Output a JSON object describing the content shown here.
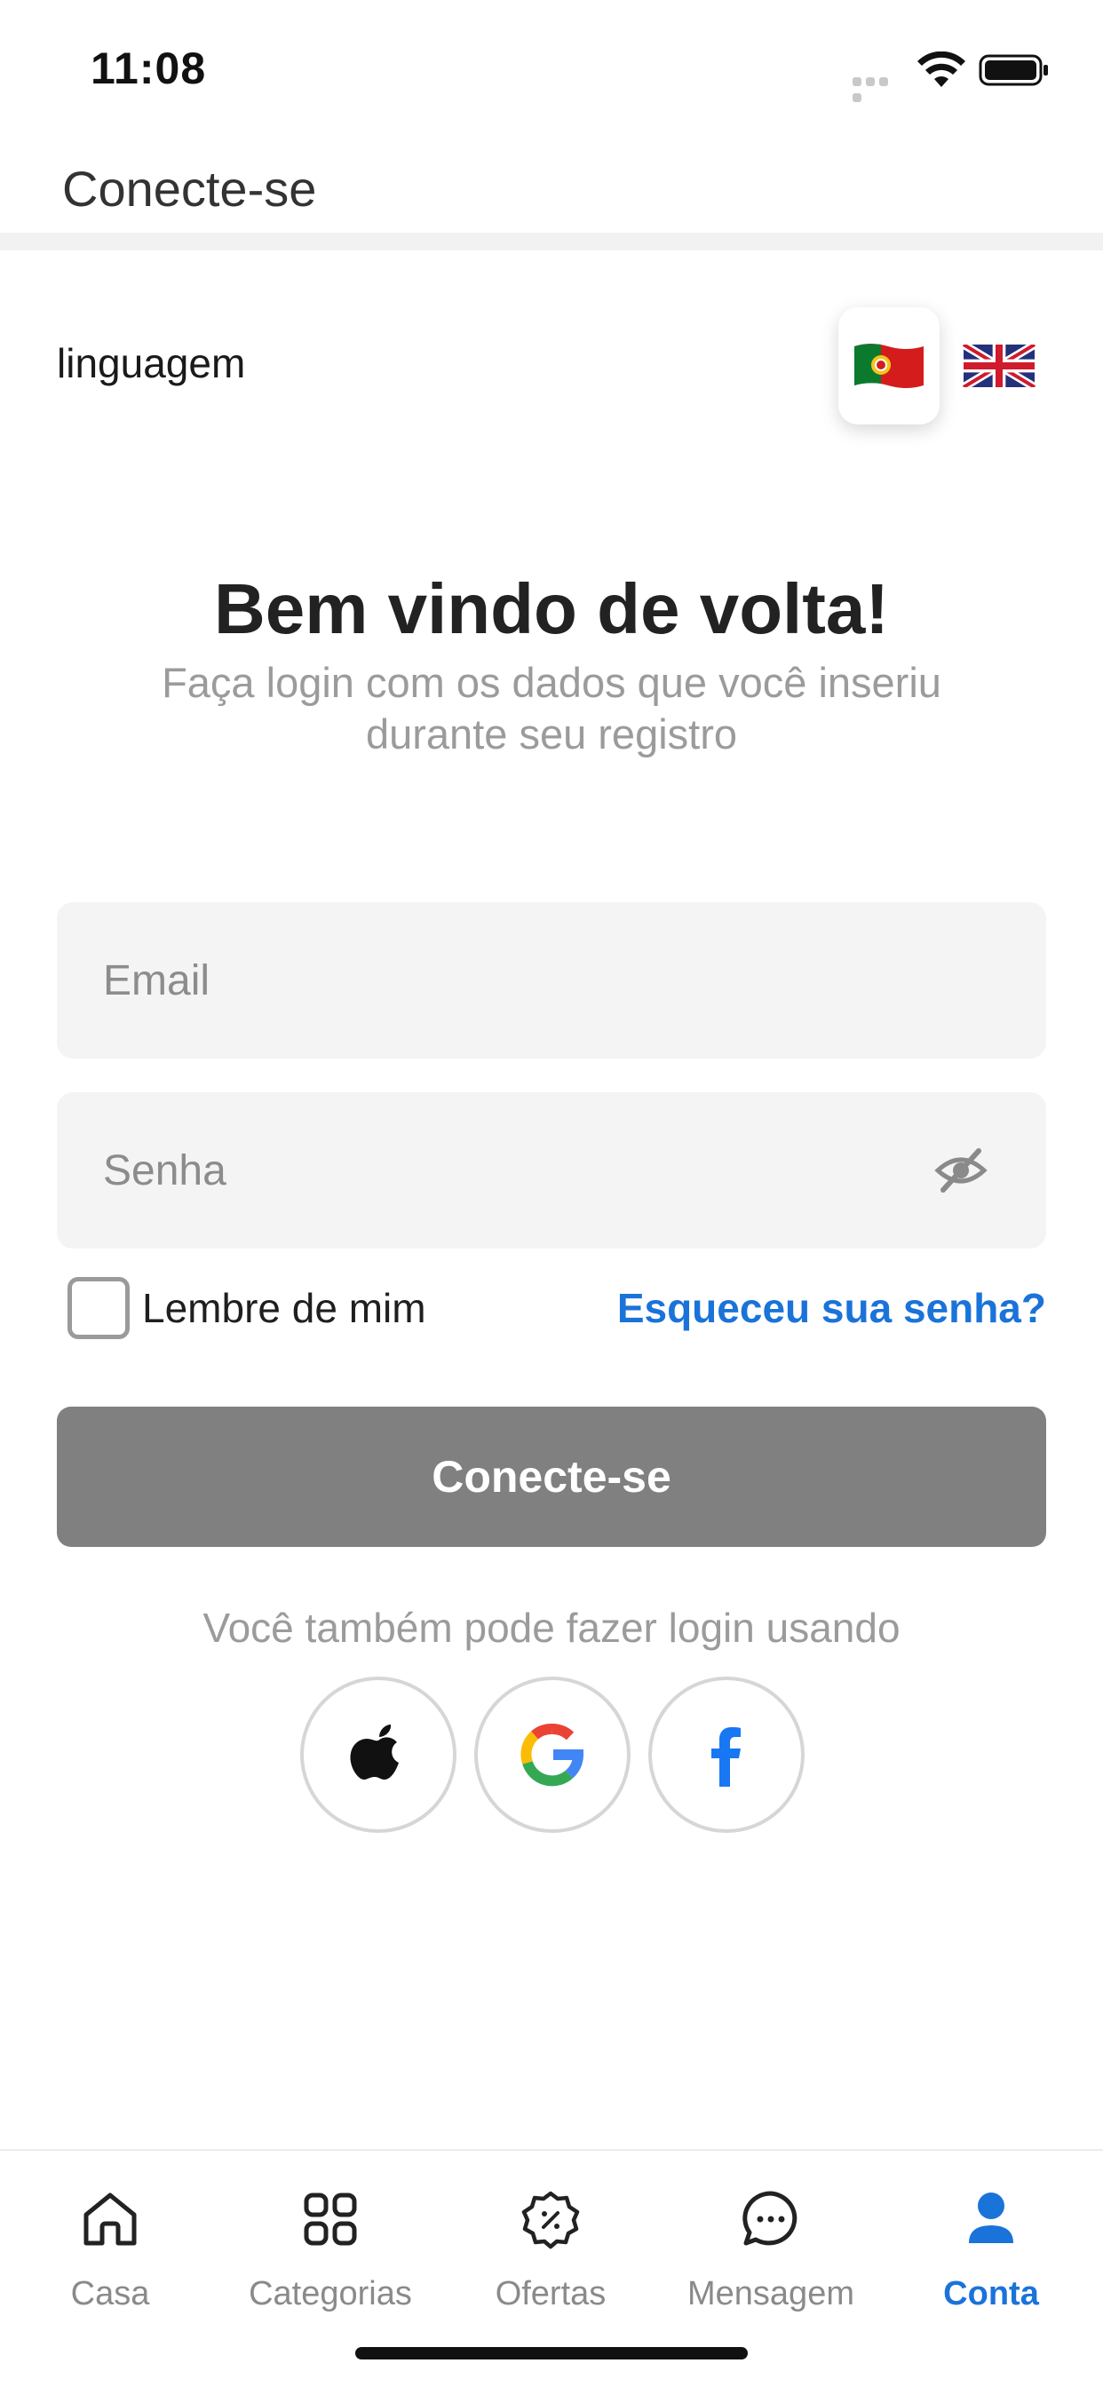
{
  "status_bar": {
    "time": "11:08"
  },
  "header": {
    "title": "Conecte-se"
  },
  "language": {
    "label": "linguagem",
    "options": [
      {
        "code": "pt",
        "icon": "portugal-flag-icon",
        "selected": true
      },
      {
        "code": "en",
        "icon": "uk-flag-icon",
        "selected": false
      }
    ]
  },
  "welcome": {
    "title": "Bem vindo de volta!",
    "subtitle": "Faça login com os dados que você inseriu durante seu registro"
  },
  "form": {
    "email_placeholder": "Email",
    "email_value": "",
    "password_placeholder": "Senha",
    "password_value": "",
    "remember_label": "Lembre de mim",
    "remember_checked": false,
    "forgot_label": "Esqueceu sua senha?",
    "submit_label": "Conecte-se"
  },
  "social": {
    "caption": "Você também pode fazer login usando",
    "providers": [
      "apple-icon",
      "google-icon",
      "facebook-icon"
    ]
  },
  "tabs": [
    {
      "label": "Casa",
      "icon": "home-icon",
      "active": false
    },
    {
      "label": "Categorias",
      "icon": "grid-icon",
      "active": false
    },
    {
      "label": "Ofertas",
      "icon": "discount-badge-icon",
      "active": false
    },
    {
      "label": "Mensagem",
      "icon": "chat-bubble-icon",
      "active": false
    },
    {
      "label": "Conta",
      "icon": "user-icon",
      "active": true
    }
  ],
  "colors": {
    "accent": "#1a73d9",
    "button_disabled": "#808080",
    "input_bg": "#f4f4f4",
    "muted_text": "#9b9b9b"
  }
}
